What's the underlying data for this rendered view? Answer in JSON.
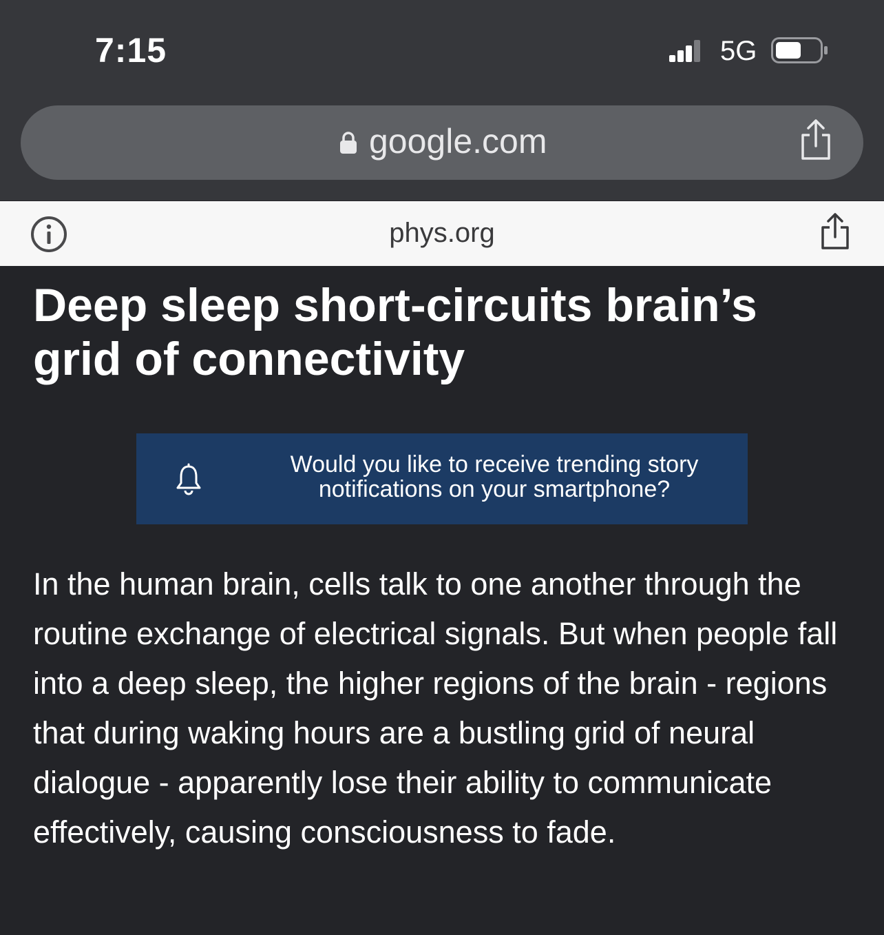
{
  "status_bar": {
    "time": "7:15",
    "network": "5G",
    "signal_bars": 4,
    "battery_level": 0.6
  },
  "browser": {
    "url": "google.com",
    "icons": {
      "lock": "lock-icon",
      "share": "share-icon"
    }
  },
  "site_bar": {
    "title": "phys.org",
    "icons": {
      "info": "info-icon",
      "share": "share-icon"
    }
  },
  "article": {
    "headline": "Deep sleep short-circuits brain’s grid of connectivity",
    "body": "In the human brain, cells talk to one another through the routine exchange of electrical signals. But when people fall into a deep sleep, the higher regions of the brain - regions that during waking hours are a bustling grid of neural dialogue - apparently lose their ability to communicate effectively, causing consciousness to fade."
  },
  "notification_banner": {
    "text": "Would you like to receive trending story notifications on your smartphone?",
    "icon": "bell-icon",
    "background": "#1c3b64"
  },
  "colors": {
    "chrome": "#36373b",
    "urlbar": "#5e6064",
    "page_background": "#232428",
    "site_bar": "#f7f7f7"
  }
}
